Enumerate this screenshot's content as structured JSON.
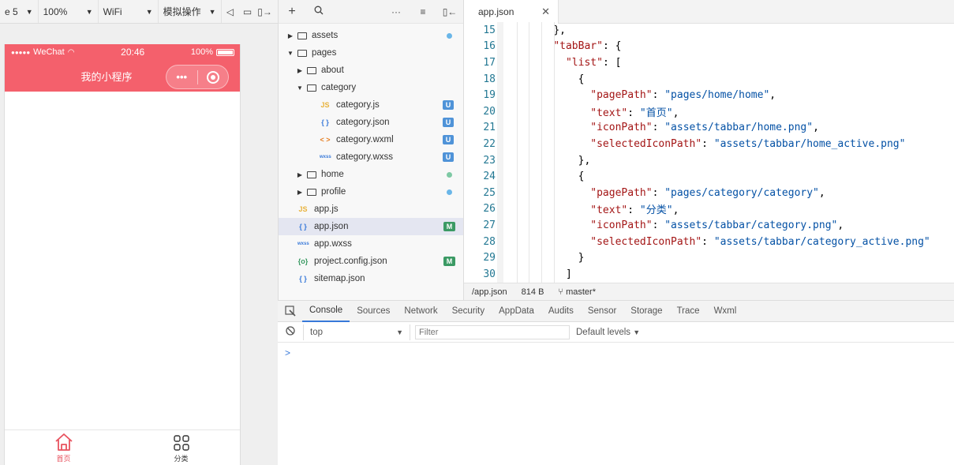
{
  "toolbar": {
    "device": "e 5",
    "zoom": "100%",
    "network": "WiFi",
    "sim_ops": "模拟操作"
  },
  "phone": {
    "carrier": "WeChat",
    "time": "20:46",
    "battery": "100%",
    "nav_title": "我的小程序",
    "capsule_more": "•••",
    "header_color": "#f4606c",
    "tabbar": [
      {
        "label": "首页",
        "icon": "home-icon",
        "color": "#e8535f"
      },
      {
        "label": "分类",
        "icon": "grid-icon",
        "color": "#333333"
      }
    ]
  },
  "explorer": {
    "tree": [
      {
        "name": "assets",
        "type": "folder",
        "indent": 0,
        "expanded": false,
        "status": "dot-blue"
      },
      {
        "name": "pages",
        "type": "folder",
        "indent": 0,
        "expanded": true,
        "status": ""
      },
      {
        "name": "about",
        "type": "folder",
        "indent": 1,
        "expanded": false,
        "status": ""
      },
      {
        "name": "category",
        "type": "folder",
        "indent": 1,
        "expanded": true,
        "status": ""
      },
      {
        "name": "category.js",
        "type": "js",
        "indent": 2,
        "status": "U"
      },
      {
        "name": "category.json",
        "type": "json",
        "indent": 2,
        "status": "U"
      },
      {
        "name": "category.wxml",
        "type": "wxml",
        "indent": 2,
        "status": "U"
      },
      {
        "name": "category.wxss",
        "type": "wxss",
        "indent": 2,
        "status": "U"
      },
      {
        "name": "home",
        "type": "folder",
        "indent": 1,
        "expanded": false,
        "status": "dot-green"
      },
      {
        "name": "profile",
        "type": "folder",
        "indent": 1,
        "expanded": false,
        "status": "dot-blue"
      },
      {
        "name": "app.js",
        "type": "js",
        "indent": 0,
        "status": ""
      },
      {
        "name": "app.json",
        "type": "json",
        "indent": 0,
        "status": "M",
        "selected": true
      },
      {
        "name": "app.wxss",
        "type": "wxss",
        "indent": 0,
        "status": ""
      },
      {
        "name": "project.config.json",
        "type": "config",
        "indent": 0,
        "status": "M"
      },
      {
        "name": "sitemap.json",
        "type": "json",
        "indent": 0,
        "status": ""
      }
    ]
  },
  "editor": {
    "tab_label": "app.json",
    "lines": [
      {
        "n": "15",
        "indent": 4,
        "parts": [
          [
            "p",
            "},"
          ]
        ]
      },
      {
        "n": "16",
        "indent": 4,
        "parts": [
          [
            "k",
            "\"tabBar\""
          ],
          [
            "p",
            ": {"
          ]
        ]
      },
      {
        "n": "17",
        "indent": 6,
        "parts": [
          [
            "k",
            "\"list\""
          ],
          [
            "p",
            ": ["
          ]
        ]
      },
      {
        "n": "18",
        "indent": 8,
        "parts": [
          [
            "p",
            "{"
          ]
        ]
      },
      {
        "n": "19",
        "indent": 10,
        "parts": [
          [
            "k",
            "\"pagePath\""
          ],
          [
            "p",
            ": "
          ],
          [
            "s",
            "\"pages/home/home\""
          ],
          [
            "p",
            ","
          ]
        ]
      },
      {
        "n": "20",
        "indent": 10,
        "parts": [
          [
            "k",
            "\"text\""
          ],
          [
            "p",
            ": "
          ],
          [
            "s",
            "\"首页\""
          ],
          [
            "p",
            ","
          ]
        ]
      },
      {
        "n": "21",
        "indent": 10,
        "parts": [
          [
            "k",
            "\"iconPath\""
          ],
          [
            "p",
            ": "
          ],
          [
            "s",
            "\"assets/tabbar/home.png\""
          ],
          [
            "p",
            ","
          ]
        ]
      },
      {
        "n": "22",
        "indent": 10,
        "parts": [
          [
            "k",
            "\"selectedIconPath\""
          ],
          [
            "p",
            ": "
          ],
          [
            "s",
            "\"assets/tabbar/home_active.png\""
          ]
        ]
      },
      {
        "n": "23",
        "indent": 8,
        "parts": [
          [
            "p",
            "},"
          ]
        ]
      },
      {
        "n": "24",
        "indent": 8,
        "parts": [
          [
            "p",
            "{"
          ]
        ]
      },
      {
        "n": "25",
        "indent": 10,
        "parts": [
          [
            "k",
            "\"pagePath\""
          ],
          [
            "p",
            ": "
          ],
          [
            "s",
            "\"pages/category/category\""
          ],
          [
            "p",
            ","
          ]
        ]
      },
      {
        "n": "26",
        "indent": 10,
        "parts": [
          [
            "k",
            "\"text\""
          ],
          [
            "p",
            ": "
          ],
          [
            "s",
            "\"分类\""
          ],
          [
            "p",
            ","
          ]
        ]
      },
      {
        "n": "27",
        "indent": 10,
        "parts": [
          [
            "k",
            "\"iconPath\""
          ],
          [
            "p",
            ": "
          ],
          [
            "s",
            "\"assets/tabbar/category.png\""
          ],
          [
            "p",
            ","
          ]
        ]
      },
      {
        "n": "28",
        "indent": 10,
        "parts": [
          [
            "k",
            "\"selectedIconPath\""
          ],
          [
            "p",
            ": "
          ],
          [
            "s",
            "\"assets/tabbar/category_active.png\""
          ]
        ]
      },
      {
        "n": "29",
        "indent": 8,
        "parts": [
          [
            "p",
            "}"
          ]
        ]
      },
      {
        "n": "30",
        "indent": 6,
        "parts": [
          [
            "p",
            "]"
          ]
        ]
      }
    ],
    "status": {
      "path": "/app.json",
      "size": "814 B",
      "branch": "master*"
    }
  },
  "console": {
    "tabs": [
      "Console",
      "Sources",
      "Network",
      "Security",
      "AppData",
      "Audits",
      "Sensor",
      "Storage",
      "Trace",
      "Wxml"
    ],
    "active_tab": "Console",
    "context": "top",
    "filter_placeholder": "Filter",
    "levels": "Default levels",
    "prompt": ">"
  }
}
